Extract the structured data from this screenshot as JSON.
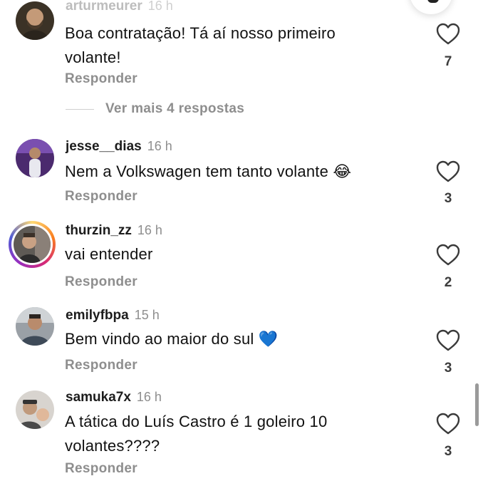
{
  "comments": [
    {
      "username": "arturmeurer",
      "time": "16 h",
      "text_lines": [
        "Boa contratação! Tá aí nosso primeiro",
        "volante!"
      ],
      "reply_label": "Responder",
      "likes": "7"
    },
    {
      "username": "jesse__dias",
      "time": "16 h",
      "text_lines": [
        "Nem a Volkswagen tem tanto volante 😂"
      ],
      "reply_label": "Responder",
      "likes": "3"
    },
    {
      "username": "thurzin_zz",
      "time": "16 h",
      "text_lines": [
        "vai entender"
      ],
      "reply_label": "Responder",
      "likes": "2"
    },
    {
      "username": "emilyfbpa",
      "time": "15 h",
      "text_lines": [
        "Bem vindo ao maior do sul 💙"
      ],
      "reply_label": "Responder",
      "likes": "3"
    },
    {
      "username": "samuka7x",
      "time": "16 h",
      "text_lines": [
        "A tática do Luís Castro é 1 goleiro 10",
        "volantes????"
      ],
      "reply_label": "Responder",
      "likes": "3"
    }
  ],
  "view_more_replies": "Ver mais 4 respostas",
  "icons": {
    "like": "heart-outline-icon"
  },
  "colors": {
    "secondary_text": "#8e8e8e",
    "story_ring": "#d62976",
    "heart_emoji": "#2f7cf6"
  }
}
